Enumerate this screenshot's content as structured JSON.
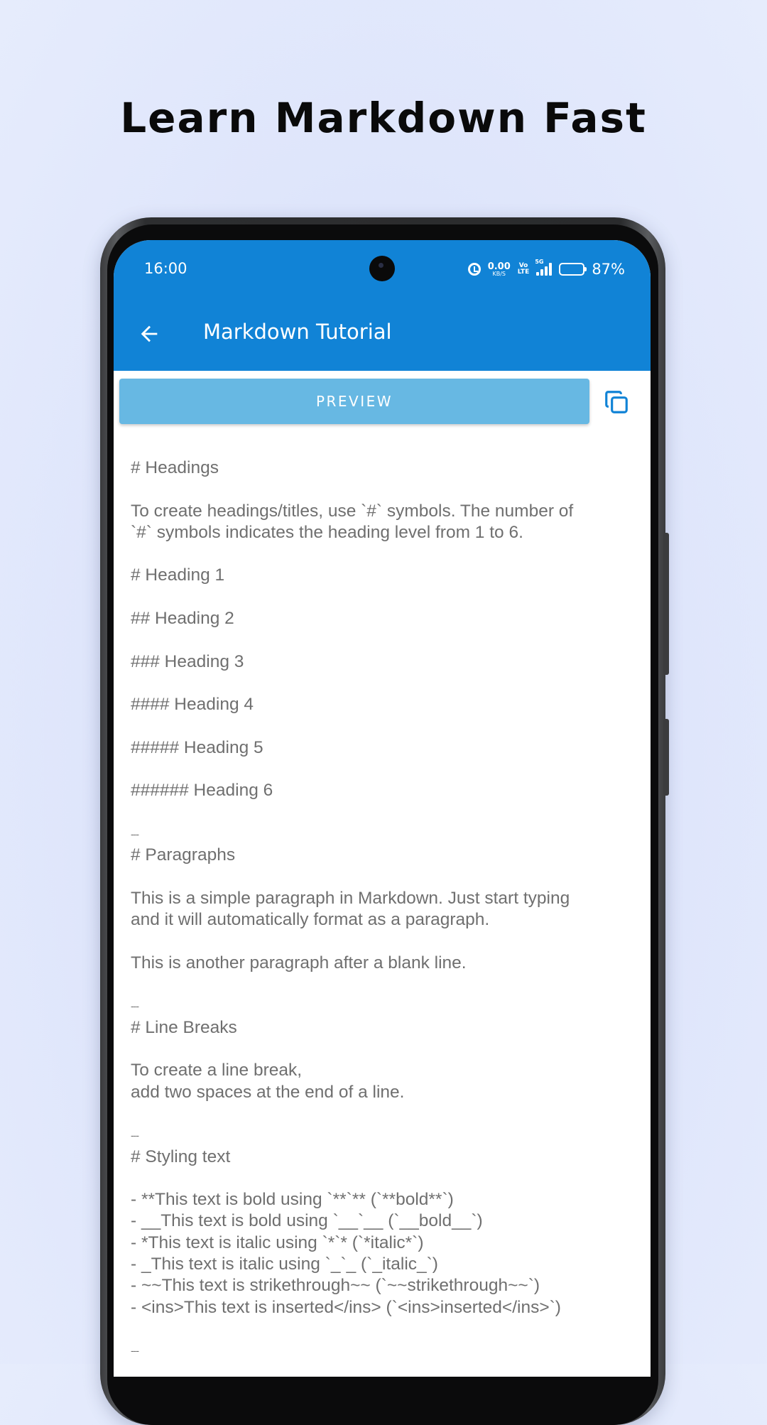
{
  "promo": {
    "title": "Learn Markdown Fast"
  },
  "status_bar": {
    "time": "16:00",
    "net_speed_value": "0.00",
    "net_speed_unit": "KB/S",
    "volte_top": "Vo",
    "volte_bottom": "LTE",
    "signal_tag": "5G",
    "battery_percent": "87%",
    "battery_level": 0.87
  },
  "toolbar": {
    "title": "Markdown Tutorial",
    "back_icon": "arrow-left-icon",
    "copy_icon": "copy-icon"
  },
  "preview_button": {
    "label": "PREVIEW"
  },
  "colors": {
    "header": "#1183d6",
    "preview_button": "#67b8e3",
    "body_text": "#6f6f6f"
  },
  "markdown_lines": [
    "# Headings",
    "",
    "To create headings/titles, use `#` symbols. The number of",
    "`#` symbols indicates the heading level from 1 to 6.",
    "",
    "# Heading 1",
    "",
    "## Heading 2",
    "",
    "### Heading 3",
    "",
    "#### Heading 4",
    "",
    "##### Heading 5",
    "",
    "###### Heading 6",
    "",
    "---",
    "# Paragraphs",
    "",
    "This is a simple paragraph in Markdown. Just start typing",
    "and it will automatically format as a paragraph.",
    "",
    "This is another paragraph after a blank line.",
    "",
    "---",
    "# Line Breaks",
    "",
    "To create a line break,",
    "add two spaces at the end of a line.",
    "",
    "---",
    "# Styling text",
    "",
    "- **This text is bold using `**`** (`**bold**`)",
    "- __This text is bold using `__`__ (`__bold__`)",
    "- *This text is italic using `*`* (`*italic*`)",
    "- _This text is italic using `_`_ (`_italic_`)",
    "- ~~This text is strikethrough~~ (`~~strikethrough~~`)",
    "- <ins>This text is inserted</ins> (`<ins>inserted</ins>`)",
    "",
    "---"
  ]
}
